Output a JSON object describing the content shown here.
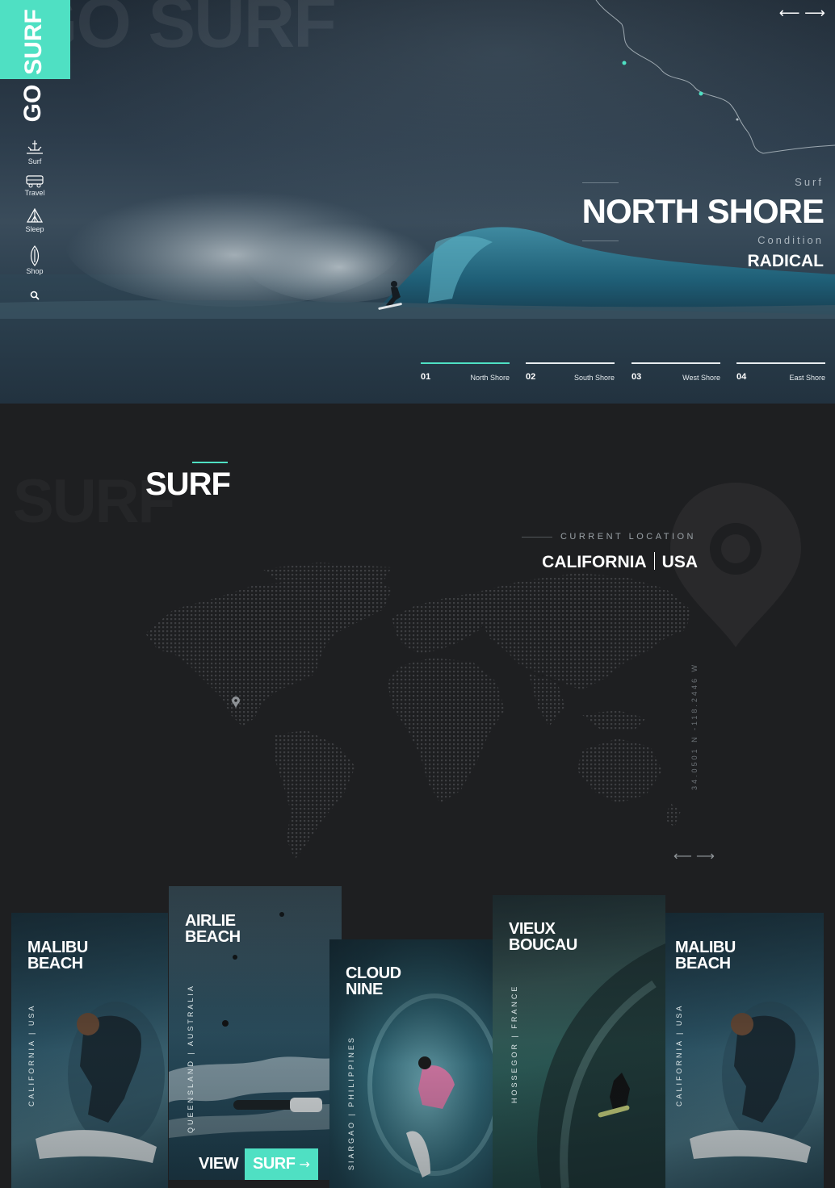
{
  "brand": {
    "logo_top": "SURF",
    "logo_bottom": "GO",
    "accent": "#4fe0c3",
    "watermark": "GO SURF"
  },
  "nav": [
    {
      "label": "Surf",
      "icon": "surfer-icon"
    },
    {
      "label": "Travel",
      "icon": "van-icon"
    },
    {
      "label": "Sleep",
      "icon": "tent-icon"
    },
    {
      "label": "Shop",
      "icon": "surfboard-icon"
    },
    {
      "label": "",
      "icon": "search-icon"
    }
  ],
  "hero": {
    "arrows": "⟵ ⟶",
    "eyebrow": "Surf",
    "title": "NORTH SHORE",
    "condition_label": "Condition",
    "condition_value": "RADICAL",
    "tabs": [
      {
        "num": "01",
        "name": "North Shore",
        "active": true
      },
      {
        "num": "02",
        "name": "South Shore",
        "active": false
      },
      {
        "num": "03",
        "name": "West Shore",
        "active": false
      },
      {
        "num": "04",
        "name": "East Shore",
        "active": false
      }
    ]
  },
  "section": {
    "watermark": "SURF",
    "title": "SURF",
    "location_label": "CURRENT LOCATION",
    "location_region": "CALIFORNIA",
    "location_country": "USA",
    "coordinates": "34.0501 N -118.2446 W",
    "arrows": "⟵ ⟶"
  },
  "cards": [
    {
      "title_line1": "MALIBU",
      "title_line2": "BEACH",
      "region": "CALIFORNIA | USA"
    },
    {
      "title_line1": "AIRLIE",
      "title_line2": "BEACH",
      "region": "QUEENSLAND | AUSTRALIA"
    },
    {
      "title_line1": "CLOUD",
      "title_line2": "NINE",
      "region": "SIARGAO | PHILIPPINES"
    },
    {
      "title_line1": "VIEUX",
      "title_line2": "BOUCAU",
      "region": "HOSSEGOR | FRANCE"
    },
    {
      "title_line1": "MALIBU",
      "title_line2": "BEACH",
      "region": "CALIFORNIA | USA"
    }
  ],
  "cta": {
    "view": "VIEW",
    "surf": "SURF",
    "arrow": "→"
  }
}
